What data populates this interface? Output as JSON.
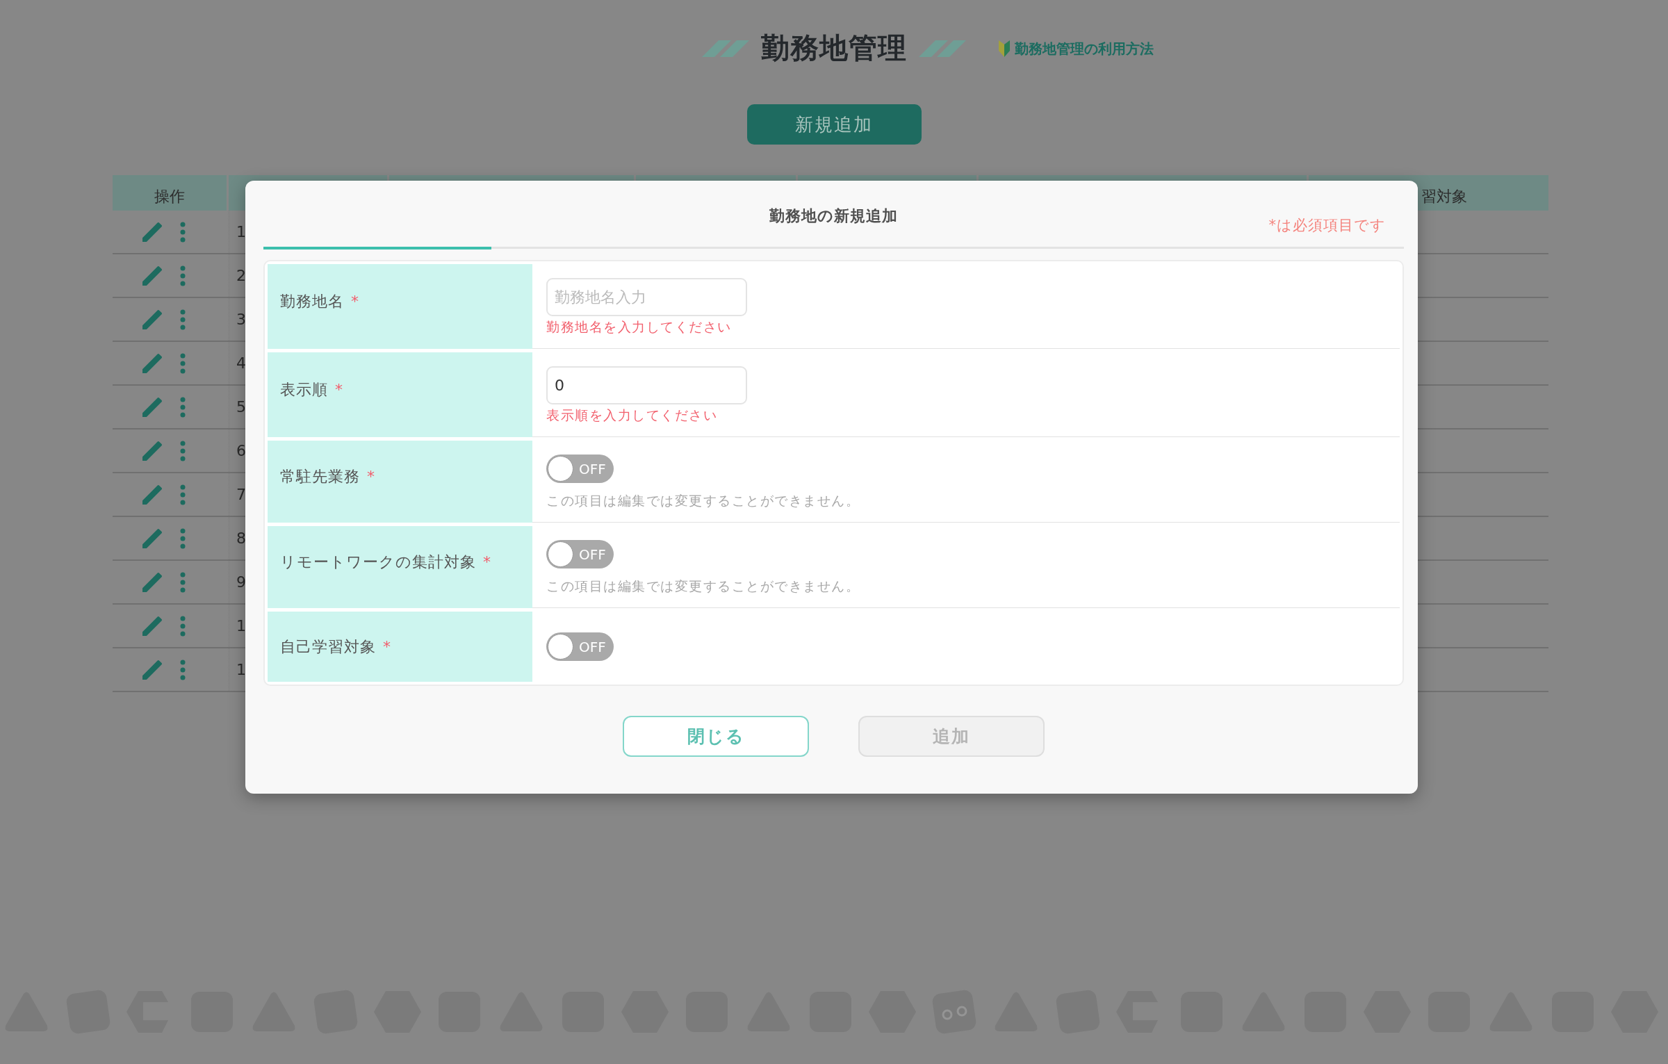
{
  "page": {
    "title": "勤務地管理",
    "help_link": "勤務地管理の利用方法",
    "add_button": "新規追加"
  },
  "table": {
    "columns": [
      {
        "label": "操作"
      },
      {
        "label": "習対象"
      }
    ],
    "rows": [
      {
        "number": "1"
      },
      {
        "number": "2"
      },
      {
        "number": "3"
      },
      {
        "number": "4"
      },
      {
        "number": "5"
      },
      {
        "number": "6"
      },
      {
        "number": "7"
      },
      {
        "number": "8"
      },
      {
        "number": "9"
      },
      {
        "number": "1"
      },
      {
        "number": "1"
      }
    ]
  },
  "modal": {
    "title": "勤務地の新規追加",
    "required_note": "*は必須項目です",
    "progress": {
      "level": 0.2
    },
    "fields": [
      {
        "kind": "text",
        "label": "勤務地名",
        "required_mark": "*",
        "placeholder": "勤務地名入力",
        "error": "勤務地名を入力してください"
      },
      {
        "kind": "text",
        "label": "表示順",
        "required_mark": "*",
        "value": "0",
        "error": "表示順を入力してください"
      },
      {
        "kind": "toggle",
        "label": "常駐先業務",
        "required_mark": "*",
        "on": false,
        "toggle_label": "OFF",
        "note": "この項目は編集では変更することができません。"
      },
      {
        "kind": "toggle",
        "label": "リモートワークの集計対象",
        "required_mark": "*",
        "on": false,
        "toggle_label": "OFF",
        "note": "この項目は編集では変更することができません。"
      },
      {
        "kind": "toggle",
        "label": "自己学習対象",
        "required_mark": "*",
        "on": false,
        "toggle_label": "OFF"
      }
    ],
    "buttons": [
      {
        "label": "閉じる",
        "disabled": false
      },
      {
        "label": "追加",
        "disabled": true
      }
    ]
  }
}
